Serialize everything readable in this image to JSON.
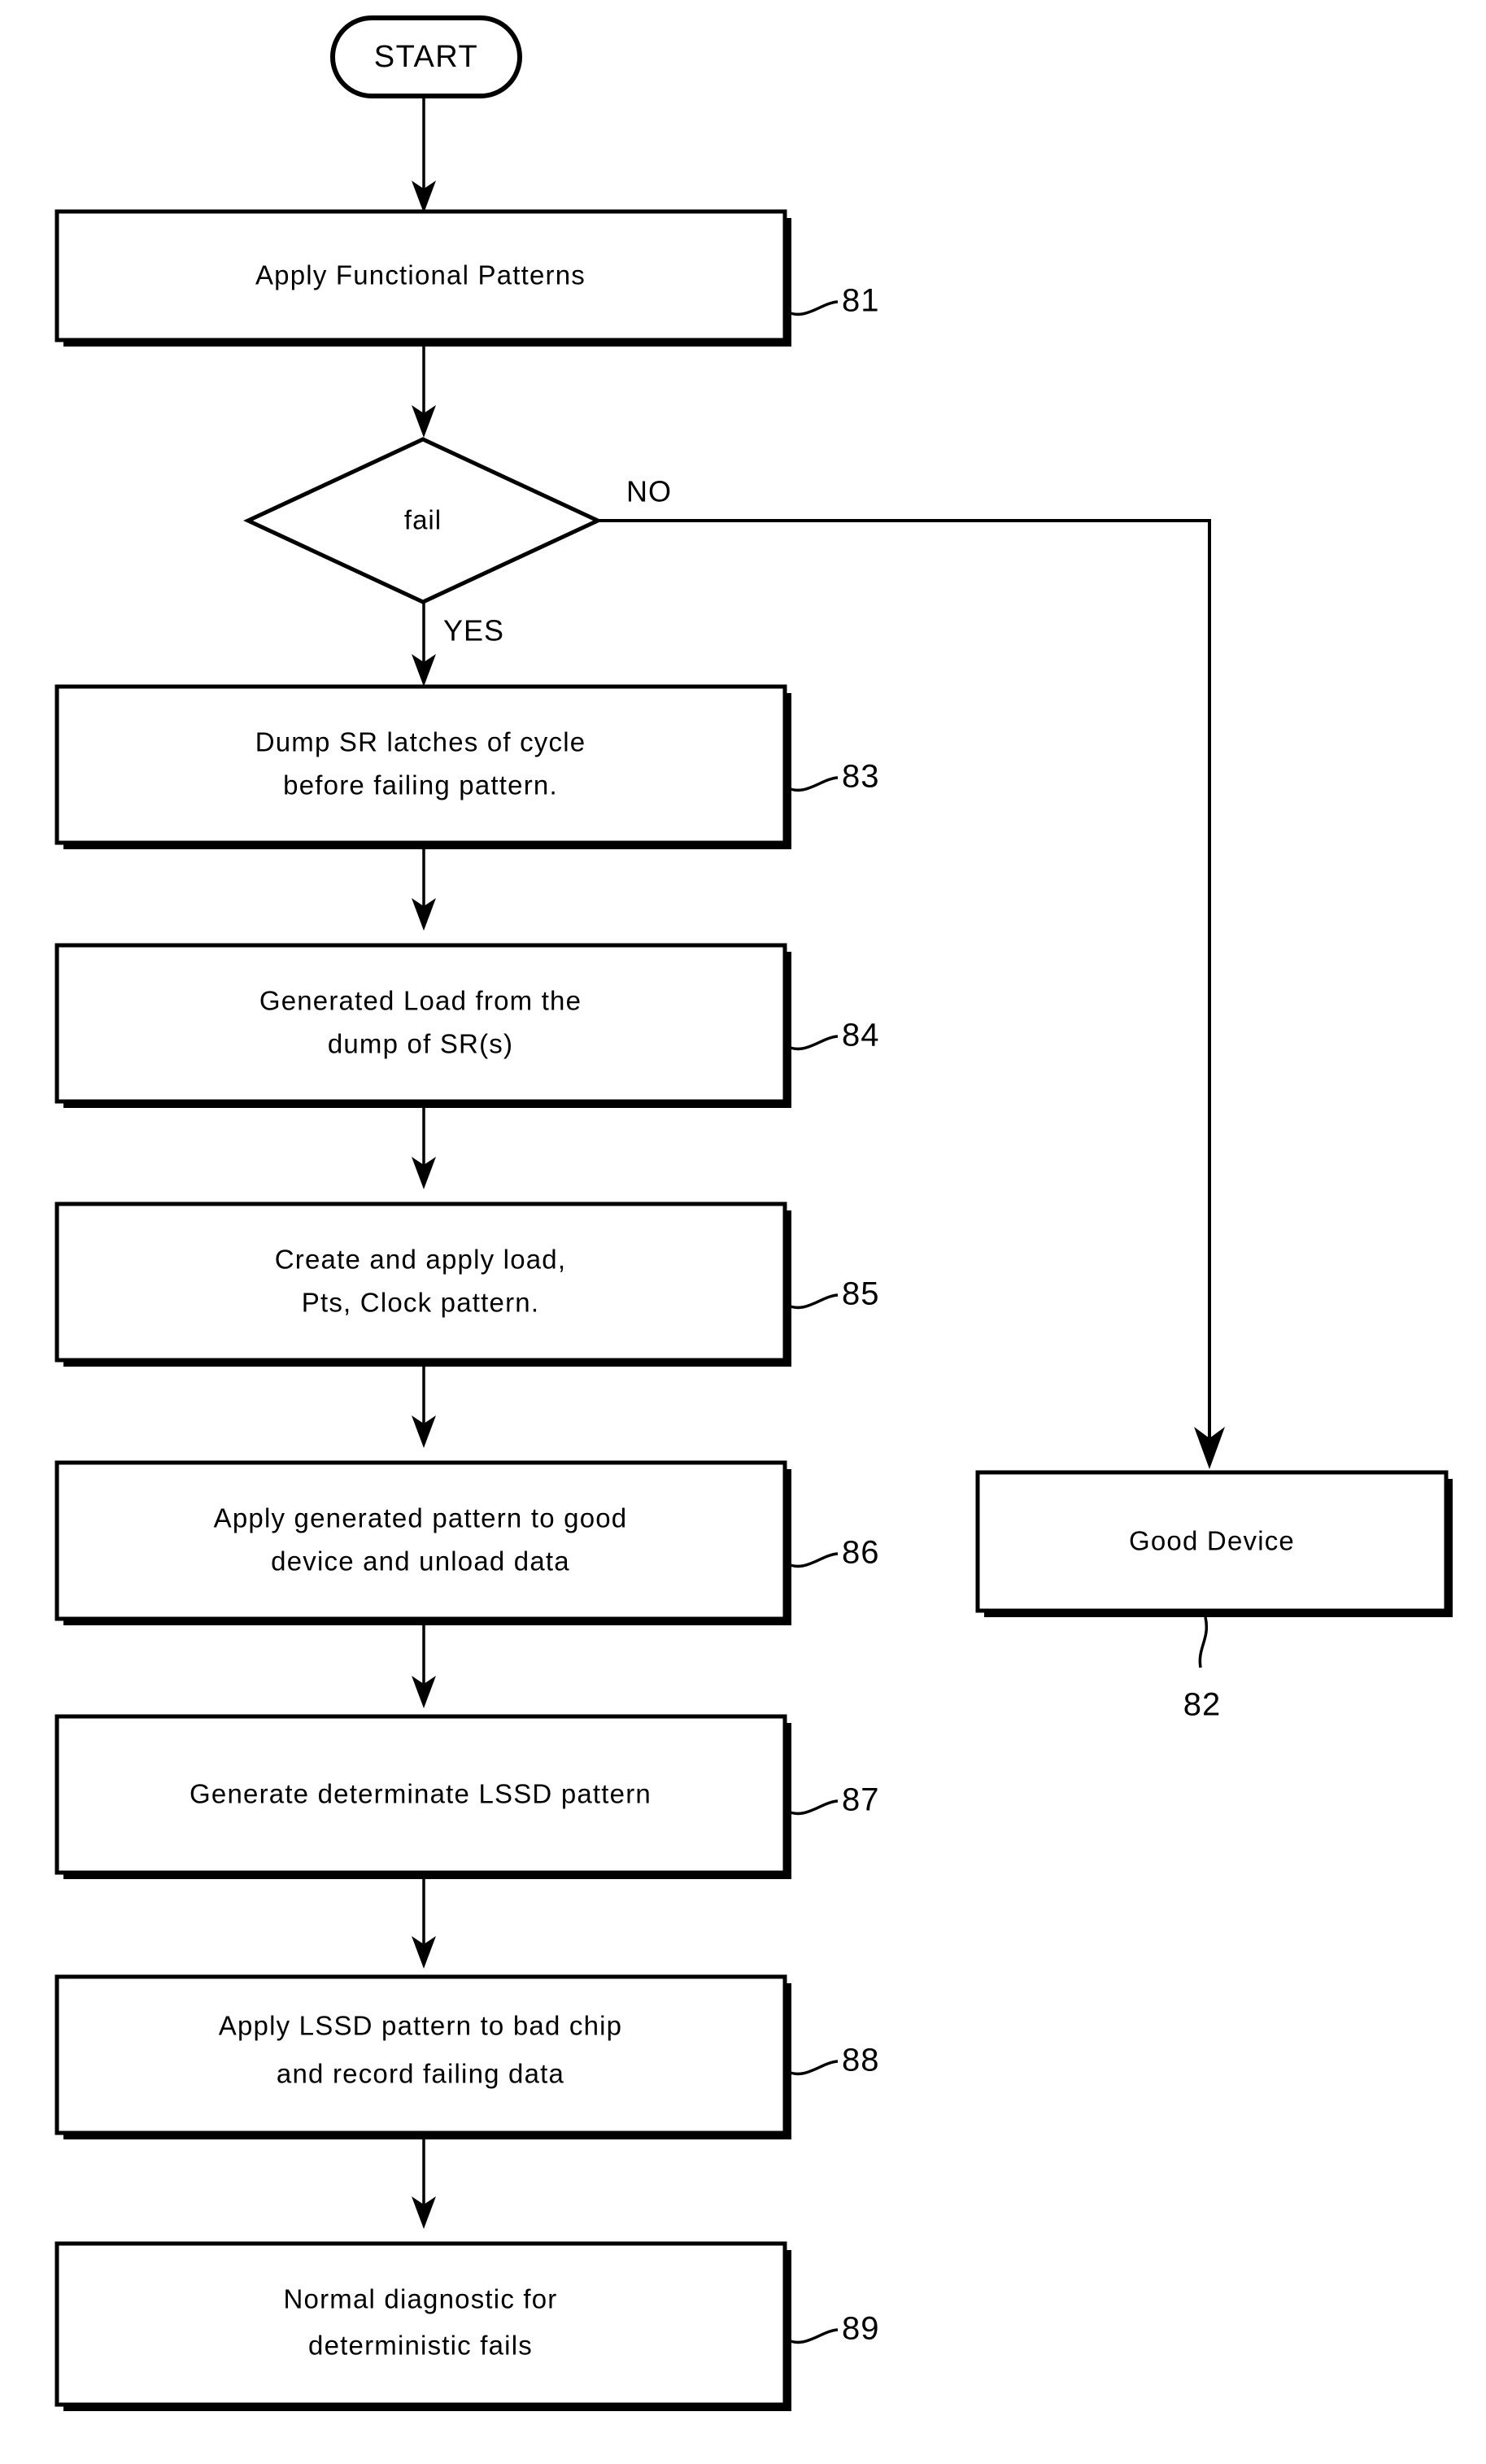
{
  "diagram": {
    "title": "Functional pattern failure diagnostic flowchart",
    "type": "flowchart",
    "start": {
      "label": "START"
    },
    "decision": {
      "label": "fail",
      "yes_label": "YES",
      "no_label": "NO"
    },
    "nodes": [
      {
        "id": "81",
        "ref": "81",
        "lines": [
          "Apply Functional Patterns"
        ]
      },
      {
        "id": "82",
        "ref": "82",
        "lines": [
          "Good Device"
        ]
      },
      {
        "id": "83",
        "ref": "83",
        "lines": [
          "Dump SR   latches of cycle",
          "before failing pattern."
        ]
      },
      {
        "id": "84",
        "ref": "84",
        "lines": [
          "Generated Load from the",
          "dump of SR(s)"
        ]
      },
      {
        "id": "85",
        "ref": "85",
        "lines": [
          "Create and apply load,",
          "Pts, Clock pattern."
        ]
      },
      {
        "id": "86",
        "ref": "86",
        "lines": [
          "Apply generated pattern to good",
          "device and unload data"
        ]
      },
      {
        "id": "87",
        "ref": "87",
        "lines": [
          "Generate determinate LSSD pattern"
        ]
      },
      {
        "id": "88",
        "ref": "88",
        "lines": [
          "Apply LSSD pattern to bad chip",
          "and record failing data"
        ]
      },
      {
        "id": "89",
        "ref": "89",
        "lines": [
          "Normal diagnostic for",
          "deterministic fails"
        ]
      }
    ],
    "colors": {
      "stroke": "#000000",
      "fill": "#ffffff",
      "background": "#ffffff"
    }
  }
}
